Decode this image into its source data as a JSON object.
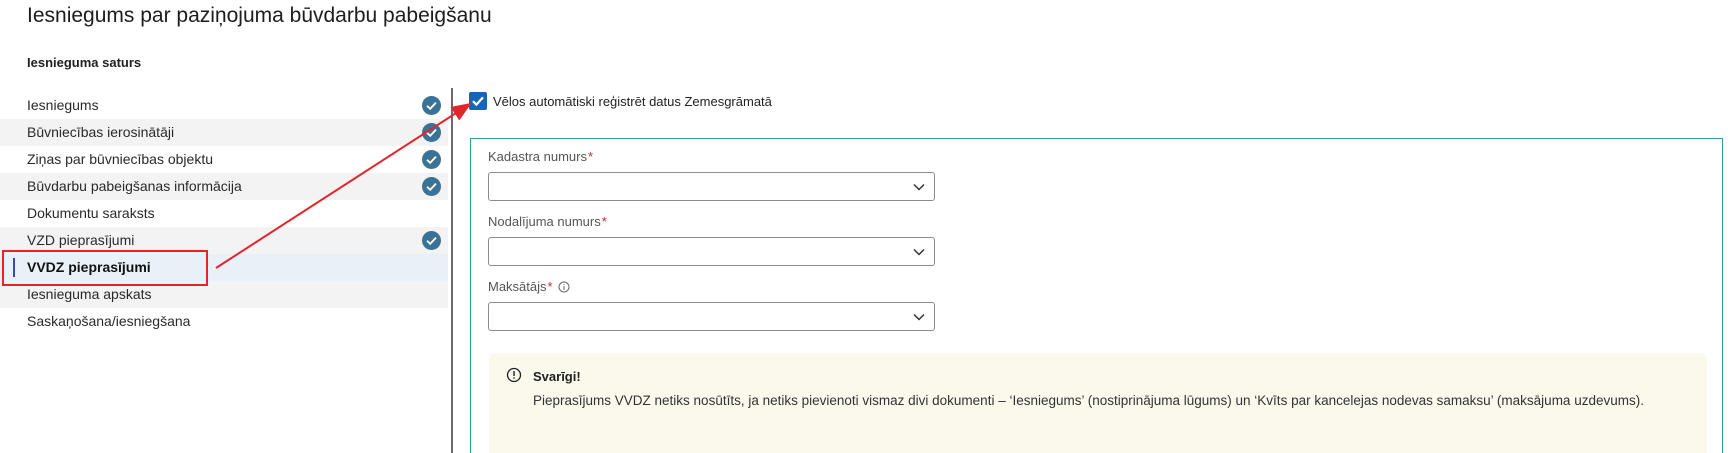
{
  "page": {
    "title": "Iesniegums par paziņojuma būvdarbu pabeigšanu",
    "section_title": "Iesnieguma saturs"
  },
  "nav": {
    "items": [
      {
        "label": "Iesniegums",
        "completed": true
      },
      {
        "label": "Būvniecības ierosinātāji",
        "completed": true
      },
      {
        "label": "Ziņas par būvniecības objektu",
        "completed": true
      },
      {
        "label": "Būvdarbu pabeigšanas informācija",
        "completed": true
      },
      {
        "label": "Dokumentu saraksts",
        "completed": false
      },
      {
        "label": "VZD pieprasījumi",
        "completed": true
      },
      {
        "label": "VVDZ pieprasījumi",
        "completed": false,
        "active": true
      },
      {
        "label": "Iesnieguma apskats",
        "completed": false
      },
      {
        "label": "Saskaņošana/iesniegšana",
        "completed": false
      }
    ]
  },
  "form": {
    "auto_register_checkbox": {
      "label": "Vēlos automātiski reģistrēt datus Zemesgrāmatā",
      "checked": true
    },
    "fields": [
      {
        "label": "Kadastra numurs",
        "required_mark": "*",
        "value": ""
      },
      {
        "label": "Nodalījuma numurs",
        "required_mark": "*",
        "value": ""
      },
      {
        "label": "Maksātājs",
        "required_mark": "*",
        "value": "",
        "has_info_icon": true
      }
    ]
  },
  "notice": {
    "icon": "alert-circle-icon",
    "title": "Svarīgi!",
    "text": "Pieprasījums VVDZ netiks nosūtīts, ja netiks pievienoti vismaz divi dokumenti – ‘Iesniegums’ (nostiprinājuma lūgums) un ‘Kvīts par kancelejas nodevas samaksu’ (maksājuma uzdevums)."
  },
  "colors": {
    "check_badge": "#3a7395",
    "checkbox": "#1565b8",
    "panel_border": "#2a9d9d",
    "annotation_red": "#e3242b",
    "notice_bg": "#fbf8ec",
    "required": "#c62828"
  }
}
